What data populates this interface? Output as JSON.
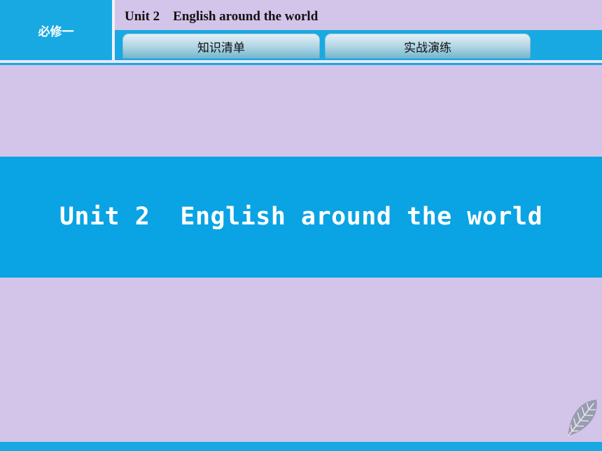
{
  "header": {
    "badge": "必修一",
    "unit_title": "Unit 2    English around the world"
  },
  "tabs": [
    {
      "label": "知识清单"
    },
    {
      "label": "实战演练"
    }
  ],
  "slide": {
    "title": "Unit 2  English around the world"
  },
  "colors": {
    "accent": "#18a9e2",
    "band": "#0aa3e4",
    "background": "#d3c4e9"
  },
  "decor": {
    "leaf_icon": "leaf-icon"
  }
}
